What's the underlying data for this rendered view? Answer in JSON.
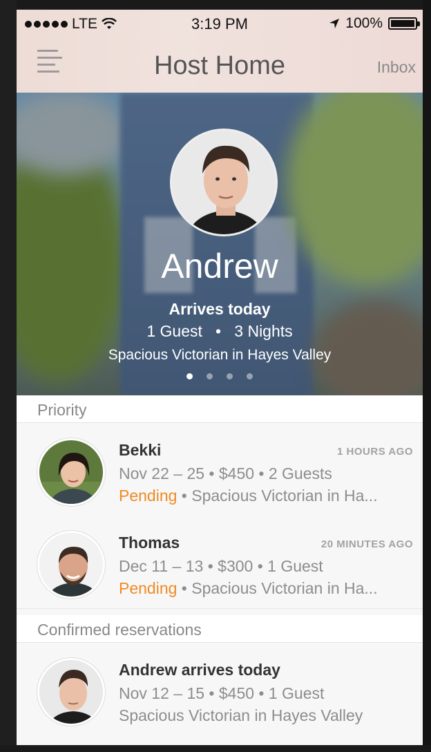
{
  "status_bar": {
    "carrier": "LTE",
    "time": "3:19 PM",
    "battery": "100%",
    "battery_level": 1.0
  },
  "nav": {
    "title": "Host Home",
    "inbox_label": "Inbox",
    "menu_icon": "hamburger-icon"
  },
  "hero": {
    "name": "Andrew",
    "arrives": "Arrives today",
    "guests": "1 Guest",
    "separator": "•",
    "nights": "3 Nights",
    "listing": "Spacious Victorian in Hayes Valley",
    "page_count": 4,
    "active_page": 1
  },
  "sections": {
    "priority": {
      "label": "Priority",
      "items": [
        {
          "name": "Bekki",
          "time": "1 HOURS AGO",
          "details": "Nov 22 – 25 • $450 • 2 Guests",
          "status": "Pending",
          "listing": " • Spacious Victorian in Ha..."
        },
        {
          "name": "Thomas",
          "time": "20 MINUTES AGO",
          "details": "Dec 11 – 13 • $300 • 1 Guest",
          "status": "Pending",
          "listing": " • Spacious Victorian in Ha..."
        }
      ]
    },
    "confirmed": {
      "label": "Confirmed reservations",
      "items": [
        {
          "name": "Andrew arrives today",
          "details": "Nov 12 – 15 • $450 • 1 Guest",
          "listing": "Spacious Victorian in Hayes Valley"
        }
      ]
    }
  },
  "colors": {
    "accent_pending": "#f08a24",
    "header_bg": "#eedcd6"
  }
}
